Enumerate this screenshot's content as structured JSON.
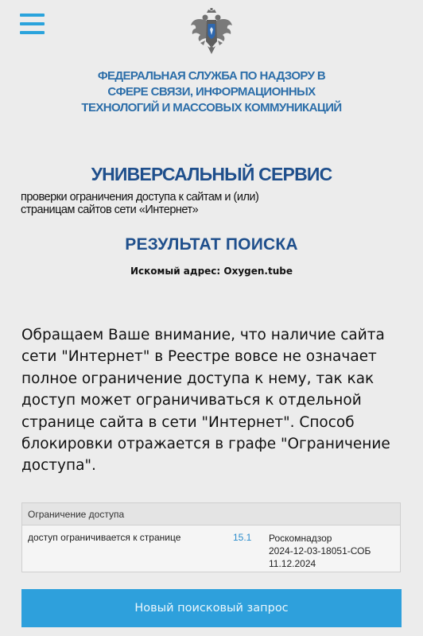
{
  "header": {
    "menu_icon": "hamburger-menu-icon",
    "emblem_icon": "coat-of-arms-emblem",
    "agency_lines": [
      "ФЕДЕРАЛЬНАЯ СЛУЖБА ПО НАДЗОРУ В",
      "СФЕРЕ СВЯЗИ, ИНФОРМАЦИОННЫХ",
      "ТЕХНОЛОГИЙ И МАССОВЫХ КОММУНИКАЦИЙ"
    ]
  },
  "service": {
    "title": "УНИВЕРСАЛЬНЫЙ СЕРВИС",
    "subtitle_lines": [
      "проверки ограничения доступа к сайтам и (или)",
      "страницам сайтов сети «Интернет»"
    ]
  },
  "result": {
    "title": "РЕЗУЛЬТАТ ПОИСКА",
    "search_address": "Искомый адрес: Oxygen.tube"
  },
  "notice": {
    "lines": [
      "Обращаем Ваше внимание, что наличие сайта",
      "сети \"Интернет\" в Реестре вовсе не означает",
      "полное ограничение доступа к нему, так как",
      "доступ может ограничиваться к отдельной",
      "странице сайта в сети \"Интернет\". Способ",
      "блокировки отражается в графе \"Ограничение",
      "доступа\"."
    ]
  },
  "table": {
    "header": "Ограничение доступа",
    "rows": [
      {
        "restriction": "доступ ограничивается к странице",
        "article": "15.1",
        "authority_lines": [
          "Роскомнадзор",
          "2024-12-03-18051-СОБ",
          "11.12.2024"
        ]
      }
    ]
  },
  "buttons": {
    "new_search": "Новый поисковый запрос"
  },
  "colors": {
    "accent_blue": "#2ea0dc",
    "title_blue": "#1f4f8c",
    "agency_blue": "#2c6ea9",
    "background": "#ececec"
  }
}
